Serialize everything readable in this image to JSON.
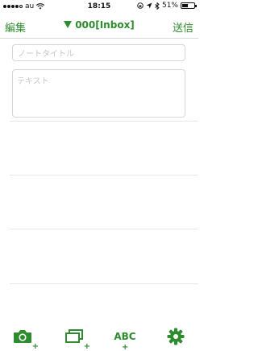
{
  "status": {
    "carrier": "au",
    "time": "18:15",
    "battery": "51%",
    "battery_level": 0.51
  },
  "nav": {
    "left_label": "編集",
    "title": "000[Inbox]",
    "right_label": "送信"
  },
  "note": {
    "title_placeholder": "ノートタイトル",
    "text_placeholder": "テキスト"
  },
  "toolbar": {
    "abc_label": "ABC",
    "icons": [
      "camera-icon",
      "photo-library-icon",
      "text-icon",
      "gear-icon"
    ]
  },
  "colors": {
    "accent": "#2e8b2e"
  }
}
